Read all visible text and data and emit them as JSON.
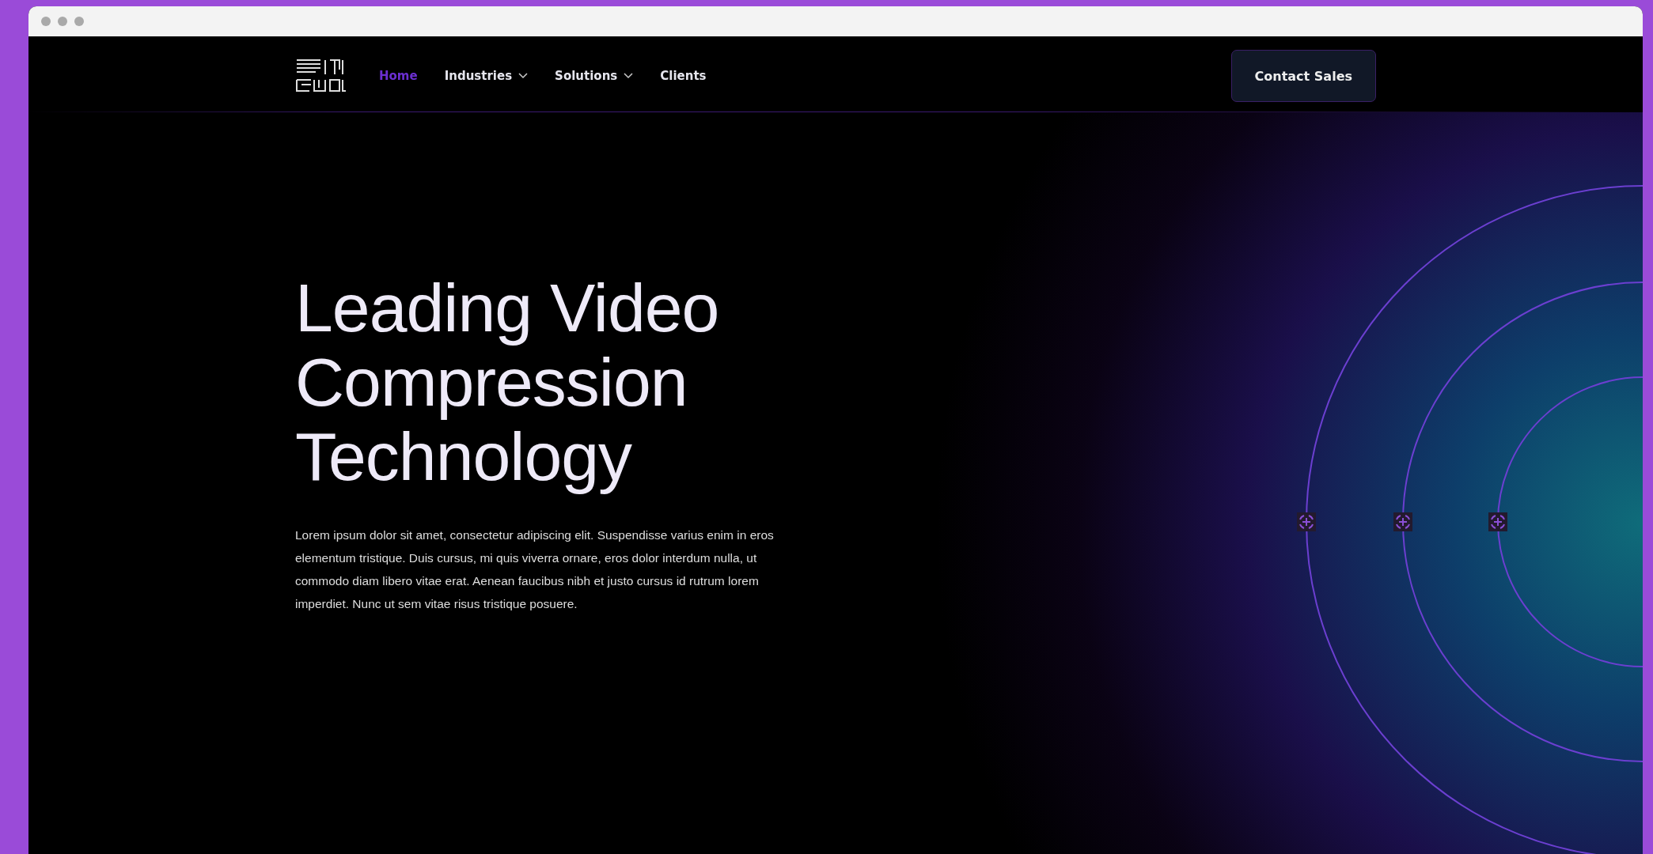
{
  "nav": {
    "items": [
      {
        "label": "Home",
        "selected": true,
        "dropdown": false
      },
      {
        "label": "Industries",
        "selected": false,
        "dropdown": true
      },
      {
        "label": "Solutions",
        "selected": false,
        "dropdown": true
      },
      {
        "label": "Clients",
        "selected": false,
        "dropdown": false
      }
    ],
    "cta": "Contact Sales"
  },
  "hero": {
    "title_lines": [
      "Leading Video",
      "Compression",
      "Technology"
    ],
    "body": "Lorem ipsum dolor sit amet, consectetur adipiscing elit. Suspendisse varius enim in eros elementum tristique. Duis cursus, mi quis viverra ornare, eros dolor interdum nulla, ut commodo diam libero vitae erat. Aenean faucibus nibh et justo cursus id rutrum lorem imperdiet. Nunc ut sem vitae risus tristique posuere."
  }
}
